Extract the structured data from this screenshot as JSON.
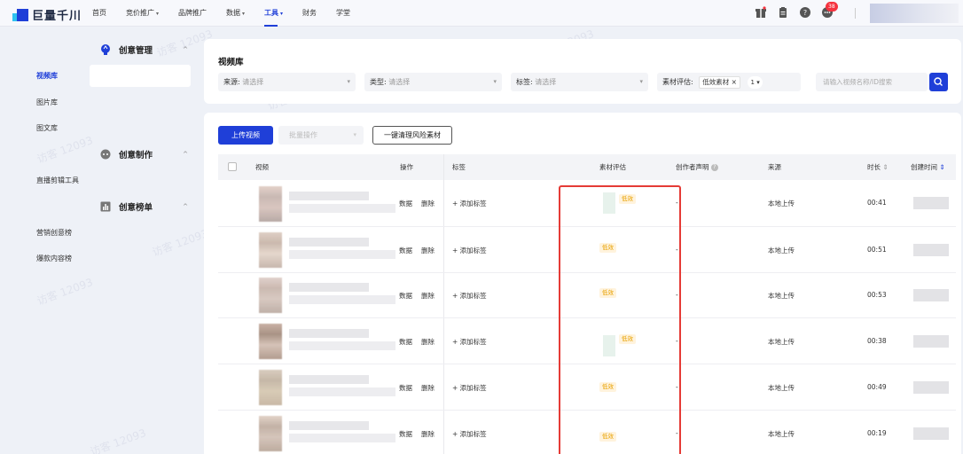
{
  "brand": {
    "name": "巨量千川"
  },
  "nav": {
    "items": [
      {
        "label": "首页",
        "caret": false
      },
      {
        "label": "竞价推广",
        "caret": true
      },
      {
        "label": "品牌推广",
        "caret": false
      },
      {
        "label": "数据",
        "caret": true
      },
      {
        "label": "工具",
        "caret": true
      },
      {
        "label": "财务",
        "caret": false
      },
      {
        "label": "学堂",
        "caret": false
      }
    ],
    "caret_glyph": "▾"
  },
  "top_right": {
    "notification_count": "38"
  },
  "sidebar": {
    "groups": [
      {
        "label": "创意管理",
        "collapse": "^",
        "items": [
          "视频库",
          "图片库",
          "图文库"
        ]
      },
      {
        "label": "创意制作",
        "collapse": "^",
        "items": [
          "直播剪辑工具"
        ]
      },
      {
        "label": "创意榜单",
        "collapse": "^",
        "items": [
          "营销创意榜",
          "爆款内容榜"
        ]
      }
    ]
  },
  "page": {
    "title": "视频库"
  },
  "filters": {
    "source": {
      "label": "来源:",
      "placeholder": "请选择"
    },
    "type": {
      "label": "类型:",
      "placeholder": "请选择"
    },
    "tag": {
      "label": "标签:",
      "placeholder": "请选择"
    },
    "eval": {
      "label": "素材评估:",
      "chip": "低效素材",
      "chip_close": "×",
      "count": "1"
    },
    "search_placeholder": "请输入视频名称/ID搜索"
  },
  "toolbar": {
    "upload": "上传视频",
    "batch": "批量操作",
    "clear_risk": "一键清理风险素材"
  },
  "table": {
    "headers": {
      "video": "视频",
      "ops": "操作",
      "tags": "标签",
      "eval": "素材评估",
      "creator": "创作者声明",
      "source": "来源",
      "duration": "时长",
      "created": "创建时间"
    },
    "sort_glyph": "⇕",
    "help_glyph": "?",
    "op_data": "数据",
    "op_delete": "删除",
    "add_tag": "+ 添加标签",
    "rows": [
      {
        "eval": "低效",
        "creator": "-",
        "source": "本地上传",
        "duration": "00:41"
      },
      {
        "eval": "低效",
        "creator": "-",
        "source": "本地上传",
        "duration": "00:51"
      },
      {
        "eval": "低效",
        "creator": "-",
        "source": "本地上传",
        "duration": "00:53"
      },
      {
        "eval": "低效",
        "creator": "-",
        "source": "本地上传",
        "duration": "00:38"
      },
      {
        "eval": "低效",
        "creator": "-",
        "source": "本地上传",
        "duration": "00:49"
      },
      {
        "eval": "低效",
        "creator": "-",
        "source": "本地上传",
        "duration": "00:19"
      }
    ]
  },
  "watermark": "访客 12093",
  "colors": {
    "primary": "#1f3fd8",
    "warning": "#e8a100",
    "highlight": "#e53b36"
  },
  "icons": [
    "gift-icon",
    "clipboard-icon",
    "help-icon",
    "message-icon",
    "bulb-icon",
    "robot-icon",
    "ranking-icon",
    "search-icon"
  ]
}
